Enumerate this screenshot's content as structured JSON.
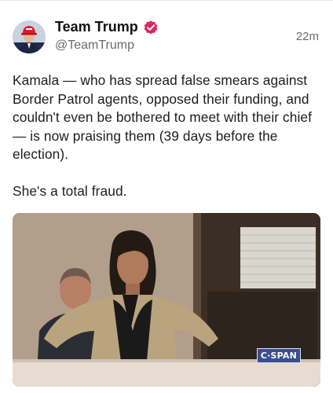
{
  "post": {
    "author_name": "Team Trump",
    "author_handle": "@TeamTrump",
    "timestamp": "22m",
    "verified": true,
    "verified_icon": "verified-badge-icon",
    "accent_color": "#e0245e",
    "paragraphs": [
      "Kamala — who has spread false smears against Border Patrol agents, opposed their funding, and couldn't even be bothered to meet with their chief — is now praising them (39 days before the election).",
      "She's a total fraud."
    ],
    "media": {
      "watermark": "C·SPAN"
    }
  }
}
